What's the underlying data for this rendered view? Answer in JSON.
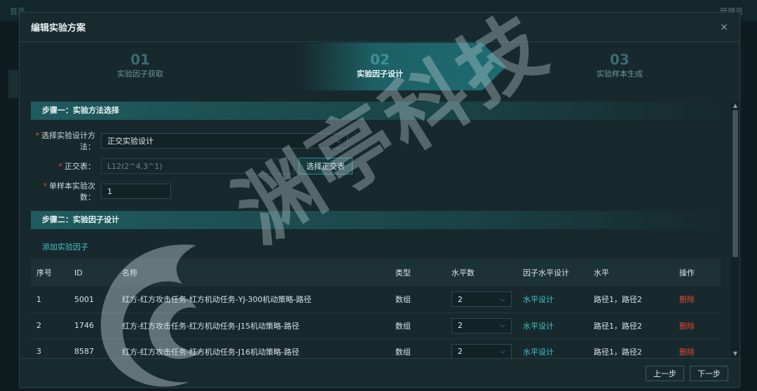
{
  "background": {
    "left_text": "首页",
    "right_text": "管理员"
  },
  "dialog": {
    "title": "编辑实验方案",
    "close_glyph": "×",
    "steps": [
      {
        "num": "01",
        "label": "实验因子获取",
        "active": false
      },
      {
        "num": "02",
        "label": "实验因子设计",
        "active": true
      },
      {
        "num": "03",
        "label": "实验样本生成",
        "active": false
      }
    ],
    "section1": {
      "title": "步骤一：实验方法选择",
      "method_label": "选择实验设计方法：",
      "method_value": "正交实验设计",
      "ortho_label": "正交表：",
      "ortho_placeholder": "L12(2^4,3^1)",
      "ortho_button": "选择正交表",
      "runs_label": "单样本实验次数：",
      "runs_value": "1"
    },
    "section2": {
      "title": "步骤二：实验因子设计",
      "add_link": "添加实验因子",
      "columns": [
        "序号",
        "ID",
        "名称",
        "类型",
        "水平数",
        "因子水平设计",
        "水平",
        "操作"
      ],
      "rows": [
        {
          "seq": "1",
          "id": "5001",
          "name": "红方-红方攻击任务-红方机动任务-YJ-300机动策略-路径",
          "type": "数组",
          "levels": "2",
          "design": "水平设计",
          "level_values": "路径1，路径2",
          "action": "删除"
        },
        {
          "seq": "2",
          "id": "1746",
          "name": "红方-红方攻击任务-红方机动任务-J15机动策略-路径",
          "type": "数组",
          "levels": "2",
          "design": "水平设计",
          "level_values": "路径1，路径2",
          "action": "删除"
        },
        {
          "seq": "3",
          "id": "8587",
          "name": "红方-红方攻击任务-红方机动任务-J16机动策略-路径",
          "type": "数组",
          "levels": "2",
          "design": "水平设计",
          "level_values": "路径1，路径2",
          "action": "删除"
        }
      ]
    },
    "footer": {
      "prev": "上一步",
      "next": "下一步"
    }
  },
  "watermark": {
    "text": "渊亭科技"
  },
  "colors": {
    "accent": "#46c2c8",
    "danger": "#e0483c",
    "dialog_bg": "#17292c",
    "section_bar": "#1f5b5f"
  }
}
